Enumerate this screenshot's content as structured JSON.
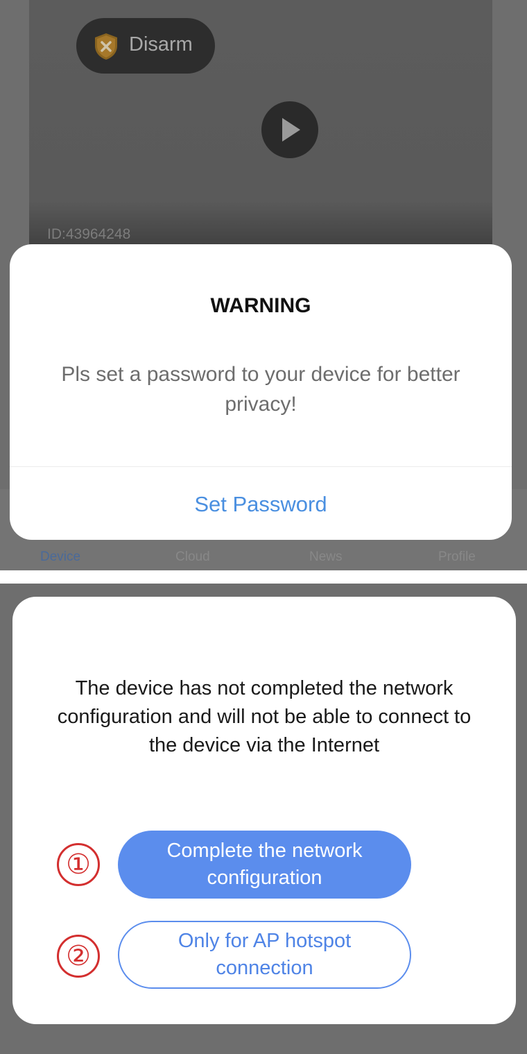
{
  "panel_top": {
    "camera": {
      "disarm_label": "Disarm",
      "device_id": "ID:43964248",
      "shield_icon": "shield-x-icon",
      "play_icon": "play-icon"
    },
    "tabs": [
      {
        "label": "Device",
        "active": true
      },
      {
        "label": "Cloud",
        "active": false
      },
      {
        "label": "News",
        "active": false
      },
      {
        "label": "Profile",
        "active": false
      }
    ],
    "dialog": {
      "title": "WARNING",
      "message": "Pls set a password to your device for better privacy!",
      "action_label": "Set Password"
    }
  },
  "panel_bottom": {
    "dialog": {
      "message": "The device has not completed the network configuration and will not be able to connect to the device via the Internet",
      "markers": [
        "①",
        "②"
      ],
      "primary_button": "Complete the network configuration",
      "secondary_button": "Only for AP hotspot connection"
    }
  },
  "colors": {
    "accent": "#5b8ded",
    "marker": "#d32f2f",
    "overlay": "#6e6e6e"
  }
}
